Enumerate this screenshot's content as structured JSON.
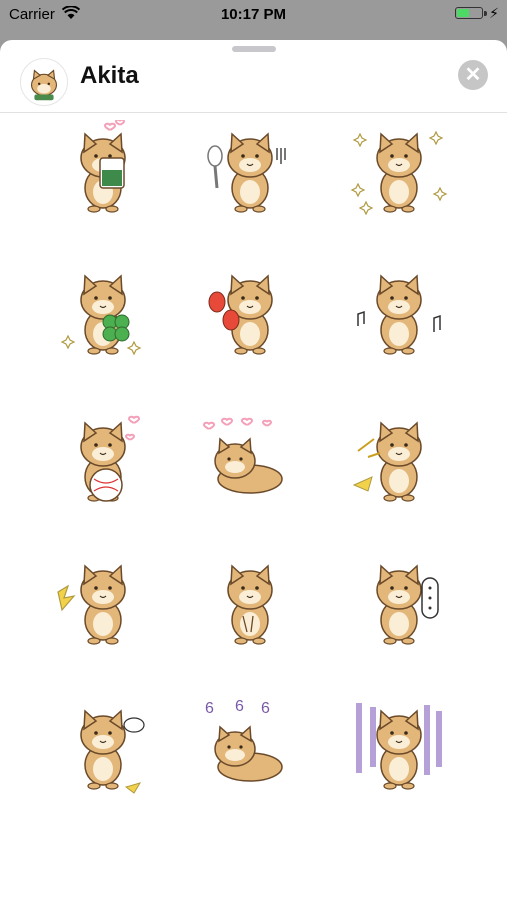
{
  "status_bar": {
    "carrier": "Carrier",
    "time": "10:17 PM",
    "battery_level": 0.4
  },
  "header": {
    "title": "Akita",
    "close_label": "✕"
  },
  "stickers": [
    {
      "name": "sticker-coffee-cup"
    },
    {
      "name": "sticker-spoon-fork"
    },
    {
      "name": "sticker-sparkle-pray"
    },
    {
      "name": "sticker-four-leaf-clover"
    },
    {
      "name": "sticker-maracas"
    },
    {
      "name": "sticker-music-dance"
    },
    {
      "name": "sticker-baseball-hearts"
    },
    {
      "name": "sticker-lying-hearts"
    },
    {
      "name": "sticker-laughing"
    },
    {
      "name": "sticker-shocked"
    },
    {
      "name": "sticker-thinking"
    },
    {
      "name": "sticker-ellipsis-speech"
    },
    {
      "name": "sticker-frustrated"
    },
    {
      "name": "sticker-lying-swirls"
    },
    {
      "name": "sticker-gloomy"
    }
  ],
  "colors": {
    "fur": "#e3b77a",
    "outline": "#6b4a2a",
    "cream": "#fbeed6",
    "accent_pink": "#f4a0b8"
  }
}
